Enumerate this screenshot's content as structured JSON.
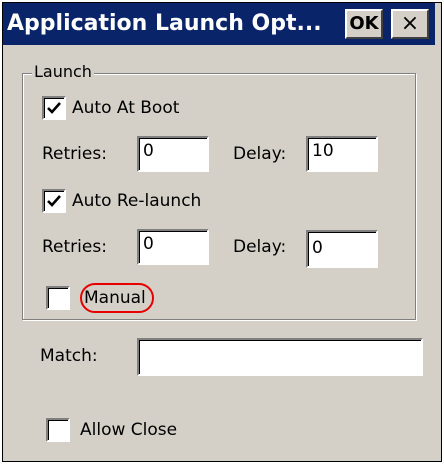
{
  "window": {
    "title": "Application Launch Opt...",
    "ok_label": "OK",
    "close_label": "×"
  },
  "launch_group": {
    "label": "Launch",
    "auto_at_boot": {
      "label": "Auto At Boot",
      "checked": true
    },
    "boot_retries": {
      "label": "Retries:",
      "value": "0"
    },
    "boot_delay": {
      "label": "Delay:",
      "value": "10"
    },
    "auto_relaunch": {
      "label": "Auto Re-launch",
      "checked": true
    },
    "relaunch_retries": {
      "label": "Retries:",
      "value": "0"
    },
    "relaunch_delay": {
      "label": "Delay:",
      "value": "0"
    },
    "manual": {
      "label": "Manual",
      "checked": false
    }
  },
  "match": {
    "label": "Match:",
    "value": ""
  },
  "allow_close": {
    "label": "Allow Close",
    "checked": false
  },
  "colors": {
    "titlebar": "#0a246a",
    "window_bg": "#d4d0c8",
    "highlight_circle": "#e60000"
  }
}
